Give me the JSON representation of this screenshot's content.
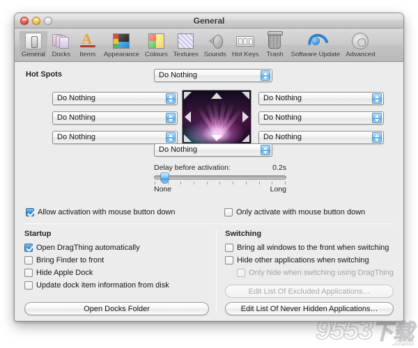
{
  "window": {
    "title": "General",
    "traffic_lights": [
      "close-button",
      "minimize-button",
      "zoom-button"
    ]
  },
  "toolbar": {
    "items": [
      {
        "label": "General",
        "icon": "general-icon",
        "selected": true
      },
      {
        "label": "Docks",
        "icon": "docks-icon",
        "selected": false
      },
      {
        "label": "Items",
        "icon": "items-icon",
        "selected": false
      },
      {
        "label": "Appearance",
        "icon": "appearance-icon",
        "selected": false
      },
      {
        "label": "Colours",
        "icon": "colours-icon",
        "selected": false
      },
      {
        "label": "Textures",
        "icon": "textures-icon",
        "selected": false
      },
      {
        "label": "Sounds",
        "icon": "sounds-icon",
        "selected": false
      },
      {
        "label": "Hot Keys",
        "icon": "hotkeys-icon",
        "selected": false
      },
      {
        "label": "Trash",
        "icon": "trash-icon",
        "selected": false
      },
      {
        "label": "Software Update",
        "icon": "software-update-icon",
        "selected": false
      },
      {
        "label": "Advanced",
        "icon": "advanced-icon",
        "selected": false
      }
    ]
  },
  "hot_spots": {
    "title": "Hot Spots",
    "top_edge": "Do Nothing",
    "bottom_edge": "Do Nothing",
    "left": [
      "Do Nothing",
      "Do Nothing",
      "Do Nothing"
    ],
    "right": [
      "Do Nothing",
      "Do Nothing",
      "Do Nothing"
    ],
    "options": [
      "Do Nothing"
    ],
    "preview_alt": "screen-preview-aurora"
  },
  "delay": {
    "label": "Delay before activation:",
    "value": "0.2s",
    "min_label": "None",
    "max_label": "Long",
    "knob_percent": 6,
    "tick_count": 11
  },
  "activation": {
    "allow": {
      "label": "Allow activation with mouse button down",
      "checked": true
    },
    "only": {
      "label": "Only activate with mouse button down",
      "checked": false
    }
  },
  "startup": {
    "title": "Startup",
    "checkboxes": [
      {
        "label": "Open DragThing automatically",
        "checked": true,
        "disabled": false
      },
      {
        "label": "Bring Finder to front",
        "checked": false,
        "disabled": false
      },
      {
        "label": "Hide Apple Dock",
        "checked": false,
        "disabled": false
      },
      {
        "label": "Update dock item information from disk",
        "checked": false,
        "disabled": false
      }
    ],
    "button": {
      "label": "Open Docks Folder",
      "disabled": false
    }
  },
  "switching": {
    "title": "Switching",
    "checkboxes": [
      {
        "label": "Bring all windows to the front when switching",
        "checked": false,
        "disabled": false,
        "indent": false
      },
      {
        "label": "Hide other applications when switching",
        "checked": false,
        "disabled": false,
        "indent": false
      },
      {
        "label": "Only hide when switching using DragThing",
        "checked": false,
        "disabled": true,
        "indent": true
      }
    ],
    "buttons": [
      {
        "label": "Edit List Of Excluded Applications…",
        "disabled": true
      },
      {
        "label": "Edit List Of Never Hidden Applications…",
        "disabled": false
      }
    ]
  },
  "watermark": {
    "text": "9553",
    "cn": "下载",
    "domain": ".com"
  },
  "colors": {
    "accent_blue": "#3c94dd",
    "window_bg": "#ececec",
    "toolbar_bg": "#c5c5c5",
    "text": "#131313",
    "disabled_text": "#a4a4a4"
  }
}
